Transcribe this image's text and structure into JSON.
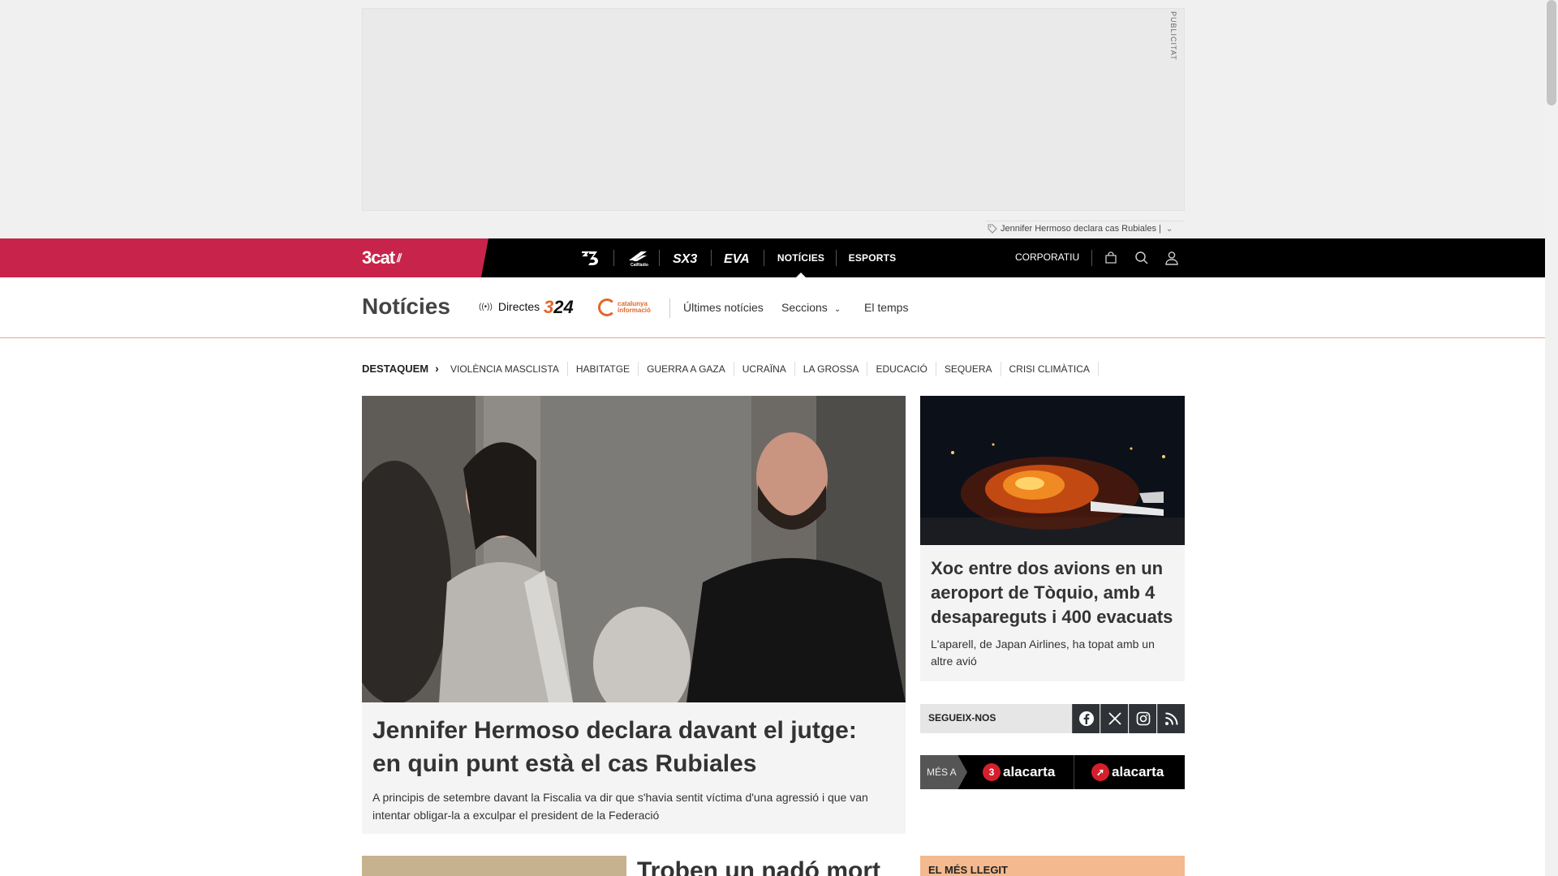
{
  "ad": {
    "label": "PUBLICITAT",
    "tag_text": "Jennifer Hermoso declara cas Rubiales |"
  },
  "topnav": {
    "brand": "3cat",
    "channels": [
      "TV3",
      "Catalunya Ràdio",
      "SX3",
      "EVA"
    ],
    "noticies": "NOTÍCIES",
    "esports": "ESPORTS",
    "corporatiu": "CORPORATIU",
    "icons": [
      "shopping-bag-icon",
      "search-icon",
      "user-icon"
    ]
  },
  "section": {
    "title": "Notícies",
    "directes": "Directes",
    "logo_324": "324",
    "logo_ci": "catalunya informació",
    "links": {
      "ultimes": "Últimes notícies",
      "seccions": "Seccions",
      "temps": "El temps"
    }
  },
  "destaquem": {
    "label": "DESTAQUEM",
    "topics": [
      "VIOLÈNCIA MASCLISTA",
      "HABITATGE",
      "GUERRA A GAZA",
      "UCRAÏNA",
      "LA GROSSA",
      "EDUCACIÓ",
      "SEQUERA",
      "CRISI CLIMÀTICA"
    ]
  },
  "lead": {
    "title": "Jennifer Hermoso declara davant el jutge: en quin punt està el cas Rubiales",
    "subtitle": "A principis de setembre davant la Fiscalia va dir que s'havia sentit víctima d'una agressió i que van intentar obligar-la a exculpar el president de la Federació"
  },
  "second": {
    "title": "Troben un nadó mort"
  },
  "side": {
    "title": "Xoc entre dos avions en un aeroport de Tòquio, amb 4 desapareguts i 400 evacuats",
    "subtitle": "L'aparell, de Japan Airlines, ha topat amb un altre avió"
  },
  "follow": {
    "label": "SEGUEIX-NOS",
    "networks": [
      "facebook-icon",
      "x-icon",
      "instagram-icon",
      "rss-icon"
    ]
  },
  "mesa": {
    "label": "MÉS A",
    "item1": "alacarta",
    "item2": "alacarta"
  },
  "mes_llegit": {
    "label": "EL MÉS LLEGIT"
  },
  "colors": {
    "brand": "#c8244b",
    "accent_orange": "#e3672a",
    "nav_bg": "#000000"
  }
}
